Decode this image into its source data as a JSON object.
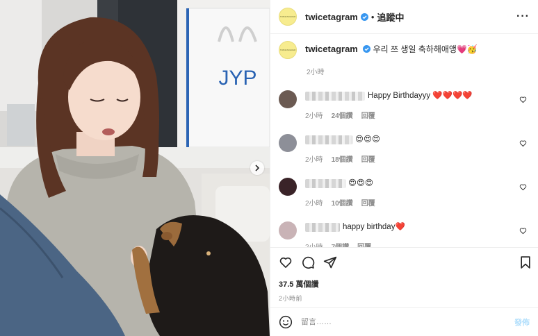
{
  "post": {
    "username": "twicetagram",
    "follow_label": "追蹤中",
    "avatar_text": "TWICETAGRAM",
    "caption": "우리 쯔 생일 축하해애앵💗🥳",
    "caption_time": "2小時",
    "likes": "37.5 萬個讚",
    "posted_ago": "2小時前"
  },
  "photo": {
    "bag_logo": "JYP"
  },
  "comments": [
    {
      "text": "Happy Birthdayyy ❤️❤️❤️❤️",
      "time": "2小時",
      "likes": "24個讚",
      "reply": "回覆",
      "avatar_color": "#6b5a52"
    },
    {
      "text": "😍😍😍",
      "time": "2小時",
      "likes": "18個讚",
      "reply": "回覆",
      "avatar_color": "#8d8f98"
    },
    {
      "text": "😍😍😍",
      "time": "2小時",
      "likes": "10個讚",
      "reply": "回覆",
      "avatar_color": "#3a2328"
    },
    {
      "text": "happy birthday❤️",
      "time": "2小時",
      "likes": "7個讚",
      "reply": "回覆",
      "avatar_color": "#c9b3b6"
    }
  ],
  "composer": {
    "placeholder": "留言……",
    "post_label": "發佈"
  },
  "colors": {
    "accent": "#0095f6",
    "post_disabled": "#b2dffc",
    "verified": "#3897f0",
    "like_red": "#ed4956"
  },
  "icons": [
    "next-arrow-icon",
    "verified-icon",
    "more-icon",
    "heart-icon",
    "comment-icon",
    "share-icon",
    "bookmark-icon",
    "emoji-icon"
  ]
}
